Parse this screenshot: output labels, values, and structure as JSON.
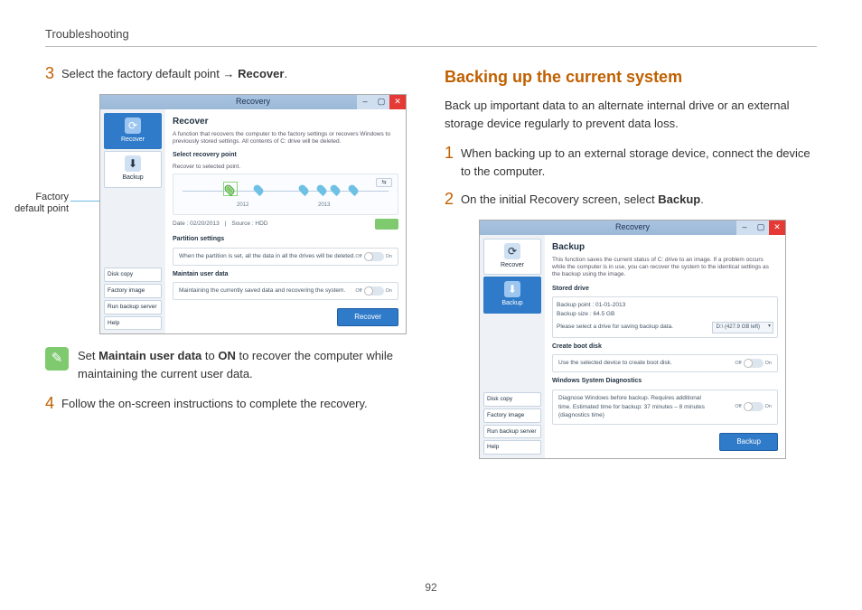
{
  "header": {
    "section": "Troubleshooting"
  },
  "pageNumber": "92",
  "left": {
    "step3": {
      "num": "3",
      "pre": "Select the factory default point → ",
      "strong": "Recover",
      "post": "."
    },
    "callout": "Factory default point",
    "shot1": {
      "title": "Recovery",
      "side": {
        "recover": "Recover",
        "backup": "Backup",
        "diskcopy": "Disk copy",
        "factoryimg": "Factory image",
        "runbackup": "Run backup server",
        "help": "Help"
      },
      "h": "Recover",
      "desc": "A function that recovers the computer to the factory settings or recovers Windows to previously stored settings. All contents of C: drive will be deleted.",
      "panelLabel": "Select recovery point",
      "panelSub": "Recover to selected point.",
      "year1": "2012",
      "year2": "2013",
      "date": "Date :  02/20/2013",
      "source": "Source :  HDD",
      "partH": "Partition settings",
      "partTxt": "When the partition is set, all the data in all the drives will be deleted.",
      "maintH": "Maintain user data",
      "maintTxt": "Maintaining the currently saved data and recovering the system.",
      "off": "Off",
      "on": "On",
      "recoverBtn": "Recover"
    },
    "note": {
      "pre": "Set ",
      "s1": "Maintain user data",
      "mid": " to ",
      "s2": "ON",
      "post": " to recover the computer while maintaining the current user data."
    },
    "step4": {
      "num": "4",
      "text": "Follow the on-screen instructions to complete the recovery."
    }
  },
  "right": {
    "title": "Backing up the current system",
    "intro": "Back up important data to an alternate internal drive or an external storage device regularly to prevent data loss.",
    "step1": {
      "num": "1",
      "text": "When backing up to an external storage device, connect the device to the computer."
    },
    "step2": {
      "num": "2",
      "pre": "On the initial Recovery screen, select ",
      "strong": "Backup",
      "post": "."
    },
    "shot2": {
      "title": "Recovery",
      "side": {
        "recover": "Recover",
        "backup": "Backup",
        "diskcopy": "Disk copy",
        "factoryimg": "Factory image",
        "runbackup": "Run backup server",
        "help": "Help"
      },
      "h": "Backup",
      "desc": "This function saves the current status of C: drive to an image. If a problem occurs while the computer is in use, you can recover the system to the identical settings as the backup using the image.",
      "storedH": "Stored drive",
      "bpoint": "Backup point : 01-01-2013",
      "bsize": "Backup size : 64.5 GB",
      "bsel": "Please select a drive for saving backup data.",
      "drive": "D:\\ (427.9 GB left)",
      "bootH": "Create boot disk",
      "bootTxt": "Use the selected device to create boot disk.",
      "diagH": "Windows System Diagnostics",
      "diagTxt": "Diagnose Windows before backup. Requires additional time. Estimated time for backup: 37 minutes – 8 minutes (diagnostics time)",
      "off": "Off",
      "on": "On",
      "backupBtn": "Backup"
    }
  }
}
